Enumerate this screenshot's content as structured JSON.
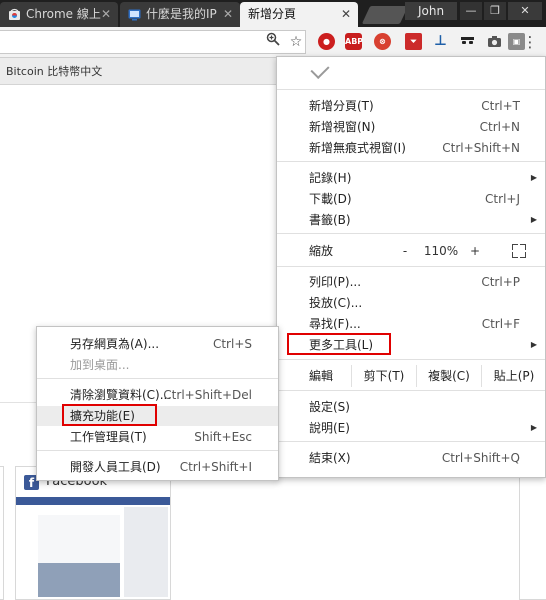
{
  "tabs": [
    {
      "title": "Chrome 線上",
      "favicon": "chrome-webstore-icon",
      "active": false
    },
    {
      "title": "什麼是我的IP",
      "favicon": "ip-site-icon",
      "active": false
    },
    {
      "title": "新增分頁",
      "favicon": "",
      "active": true
    }
  ],
  "window": {
    "user": "John"
  },
  "bookmarks": {
    "item": "Bitcoin 比特幣中文"
  },
  "thumbnails": {
    "facebook": "Facebook"
  },
  "menu": {
    "new_items": [
      {
        "label": "新增分頁(T)",
        "shortcut": "Ctrl+T"
      },
      {
        "label": "新增視窗(N)",
        "shortcut": "Ctrl+N"
      },
      {
        "label": "新增無痕式視窗(I)",
        "shortcut": "Ctrl+Shift+N"
      }
    ],
    "history_items": [
      {
        "label": "記錄(H)",
        "shortcut": "",
        "submenu": true
      },
      {
        "label": "下載(D)",
        "shortcut": "Ctrl+J",
        "submenu": false
      },
      {
        "label": "書籤(B)",
        "shortcut": "",
        "submenu": true
      }
    ],
    "zoom": {
      "label": "縮放",
      "minus": "-",
      "value": "110%",
      "plus": "+"
    },
    "print_items": [
      {
        "label": "列印(P)...",
        "shortcut": "Ctrl+P"
      },
      {
        "label": "投放(C)...",
        "shortcut": ""
      },
      {
        "label": "尋找(F)...",
        "shortcut": "Ctrl+F"
      }
    ],
    "more_tools": {
      "label": "更多工具(L)"
    },
    "edit": {
      "label": "編輯",
      "cut": "剪下(T)",
      "copy": "複製(C)",
      "paste": "貼上(P)"
    },
    "settings": {
      "label": "設定(S)"
    },
    "help": {
      "label": "說明(E)"
    },
    "exit": {
      "label": "結束(X)",
      "shortcut": "Ctrl+Shift+Q"
    }
  },
  "submenu": {
    "items": [
      {
        "label": "另存網頁為(A)...",
        "shortcut": "Ctrl+S"
      },
      {
        "label": "加到桌面...",
        "shortcut": ""
      },
      {
        "label": "清除瀏覽資料(C)...",
        "shortcut": "Ctrl+Shift+Del"
      },
      {
        "label": "擴充功能(E)",
        "shortcut": ""
      },
      {
        "label": "工作管理員(T)",
        "shortcut": "Shift+Esc"
      },
      {
        "label": "開發人員工具(D)",
        "shortcut": "Ctrl+Shift+I"
      }
    ]
  },
  "extensions": [
    {
      "name": "lastpass-icon",
      "badge": "1",
      "color": "#cc1f1f"
    },
    {
      "name": "adblock-plus-icon",
      "label": "ABP",
      "badge": "1",
      "color": "#c81e1e"
    },
    {
      "name": "disconnect-icon",
      "color": "#d84030"
    },
    {
      "name": "pdf-icon",
      "color": "#cc2a2a"
    },
    {
      "name": "stamp-icon",
      "color": "#1e5fa8"
    },
    {
      "name": "incognito-mask-icon",
      "color": "#222222"
    },
    {
      "name": "camera-icon",
      "color": "#555555"
    },
    {
      "name": "cast-icon",
      "color": "#777777"
    }
  ],
  "colors": {
    "highlight": "#e00000",
    "tabstrip": "#1f1f1f",
    "facebook": "#3b5998"
  }
}
